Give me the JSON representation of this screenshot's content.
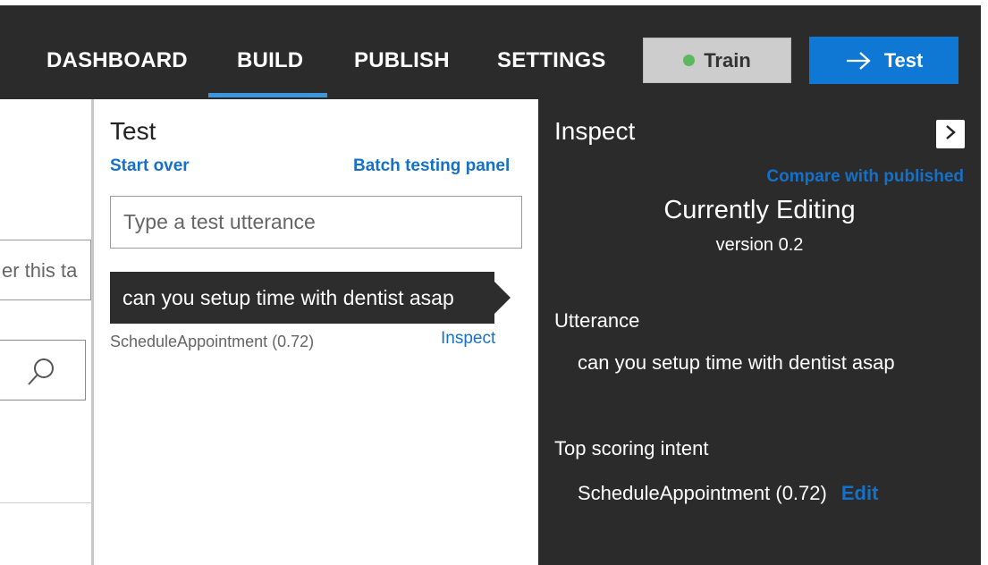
{
  "topnav": {
    "tabs": [
      {
        "label": "DASHBOARD",
        "active": false
      },
      {
        "label": "BUILD",
        "active": true
      },
      {
        "label": "PUBLISH",
        "active": false
      },
      {
        "label": "SETTINGS",
        "active": false
      }
    ],
    "train_button": {
      "label": "Train",
      "status_color": "#5cb85c",
      "icon": "status-dot-icon"
    },
    "test_button": {
      "label": "Test",
      "icon": "arrow-right-icon"
    }
  },
  "background_page": {
    "filter_text": "er this ta",
    "search_icon": "search-icon"
  },
  "test_panel": {
    "title": "Test",
    "start_over": "Start over",
    "batch_testing": "Batch testing panel",
    "input": {
      "placeholder": "Type a test utterance",
      "value": ""
    },
    "results": [
      {
        "utterance": "can you setup time with dentist asap",
        "intent": "ScheduleAppointment (0.72)",
        "inspect_label": "Inspect"
      }
    ]
  },
  "inspect_panel": {
    "title": "Inspect",
    "collapse_icon": "chevron-right-icon",
    "compare_link": "Compare with published",
    "editing_heading": "Currently Editing",
    "version": "version 0.2",
    "utterance_label": "Utterance",
    "utterance_value": "can you setup time with dentist asap",
    "top_intent_label": "Top scoring intent",
    "top_intent_value": "ScheduleAppointment (0.72)",
    "edit_label": "Edit"
  },
  "colors": {
    "topbar": "#2b2b2b",
    "accent_blue": "#0f78d4",
    "link_blue": "#1570c9",
    "active_underline": "#3a96dd"
  }
}
